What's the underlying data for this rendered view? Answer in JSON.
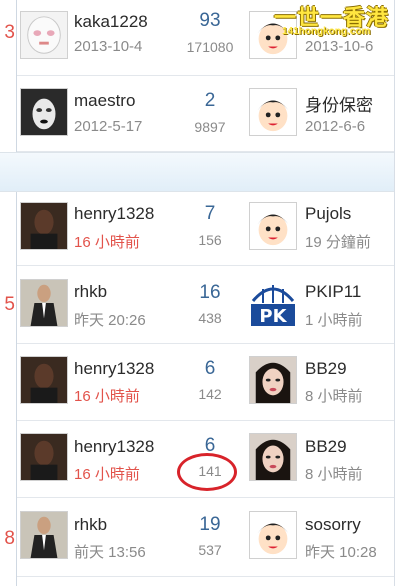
{
  "watermark": {
    "line1": "一世一香港",
    "line2": "141hongkong.com"
  },
  "rows": [
    {
      "left_num": "3",
      "author": {
        "name": "kaka1228",
        "time": "2013-10-4",
        "time_red": false,
        "avatar": "mask-avatar"
      },
      "counts": {
        "replies": "93",
        "views": "171080"
      },
      "last": {
        "name": "",
        "time": "2013-10-6",
        "avatar": "cartoon-avatar"
      }
    },
    {
      "left_num": "",
      "author": {
        "name": "maestro",
        "time": "2012-5-17",
        "time_red": false,
        "avatar": "woman-avatar"
      },
      "counts": {
        "replies": "2",
        "views": "9897"
      },
      "last": {
        "name": "身份保密",
        "time": "2012-6-6",
        "avatar": "cartoon-avatar"
      }
    },
    {
      "left_num": "",
      "author": {
        "name": "henry1328",
        "time": "16 小時前",
        "time_red": true,
        "avatar": "man-avatar"
      },
      "counts": {
        "replies": "7",
        "views": "156"
      },
      "last": {
        "name": "Pujols",
        "time": "19 分鐘前",
        "avatar": "cartoon-avatar"
      }
    },
    {
      "left_num": "5",
      "author": {
        "name": "rhkb",
        "time": "昨天 20:26",
        "time_red": false,
        "avatar": "suit-avatar"
      },
      "counts": {
        "replies": "16",
        "views": "438"
      },
      "last": {
        "name": "PKIP11",
        "time": "1 小時前",
        "avatar": "pk-logo-avatar"
      }
    },
    {
      "left_num": "",
      "author": {
        "name": "henry1328",
        "time": "16 小時前",
        "time_red": true,
        "avatar": "man-avatar"
      },
      "counts": {
        "replies": "6",
        "views": "142"
      },
      "last": {
        "name": "BB29",
        "time": "8 小時前",
        "avatar": "girl-avatar"
      }
    },
    {
      "left_num": "",
      "author": {
        "name": "henry1328",
        "time": "16 小時前",
        "time_red": true,
        "avatar": "man-avatar"
      },
      "counts": {
        "replies": "6",
        "views": "141"
      },
      "last": {
        "name": "BB29",
        "time": "8 小時前",
        "avatar": "girl-avatar"
      }
    },
    {
      "left_num": "8",
      "author": {
        "name": "rhkb",
        "time": "前天 13:56",
        "time_red": false,
        "avatar": "suit-avatar"
      },
      "counts": {
        "replies": "19",
        "views": "537"
      },
      "last": {
        "name": "sosorry",
        "time": "昨天 10:28",
        "avatar": "cartoon-avatar"
      }
    }
  ],
  "colors": {
    "accent_count": "#3a6796",
    "recent_time": "#e2534b",
    "highlight_circle": "#d8232a"
  }
}
